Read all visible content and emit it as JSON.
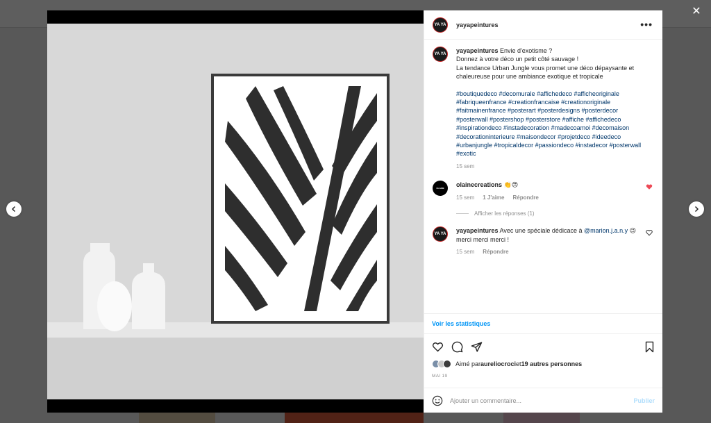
{
  "post": {
    "username": "yayapeintures",
    "avatar_text": "YA YA",
    "caption": "Envie d'exotisme ?\nDonnez à votre déco un petit côté sauvage !\nLa tendance Urban Jungle vous promet une déco dépaysante et chaleureuse pour une ambiance exotique et tropicale",
    "hashtags": "#boutiquedeco #decomurale #affichedeco #afficheoriginale #fabriqueenfrance #creationfrancaise #creationoriginale #faitmainenfrance #posterart #posterdesigns #posterdecor #posterwall #postershop #posterstore #affiche #affichedeco #inspirationdeco #instadecoration #madecoamoi #decomaison #decorationinterieure #maisondecor #projetdeco #ideedeco #urbanjungle #tropicaldecor #passiondeco #instadecor #posterwall #exotic",
    "caption_time": "15 sem"
  },
  "comments": [
    {
      "username": "olainecreations",
      "text": "👏😍",
      "time": "15 sem",
      "likes": "1 J'aime",
      "reply": "Répondre",
      "liked": true,
      "avatar_text": "OLAINE"
    },
    {
      "username": "yayapeintures",
      "text_before": "Avec une spéciale dédicace à ",
      "mention": "@marion.j.a.n.y",
      "text_after": " 😉 merci merci merci !",
      "time": "15 sem",
      "reply": "Répondre",
      "liked": false,
      "avatar_text": "YA YA"
    }
  ],
  "show_replies": "Afficher les réponses (1)",
  "stats_link": "Voir les statistiques",
  "likes": {
    "prefix": "Aimé par ",
    "user": "aureliocroci",
    "middle": " et ",
    "others": "19 autres personnes"
  },
  "date": "MAI 19",
  "comment_input": {
    "placeholder": "Ajouter un commentaire..."
  },
  "publish_label": "Publier",
  "close_label": "✕",
  "colors": {
    "link": "#00376b",
    "accent": "#0095f6",
    "like_red": "#ed4956"
  },
  "icons": [
    "close-icon",
    "chevron-left-icon",
    "chevron-right-icon",
    "more-icon",
    "heart-icon",
    "comment-icon",
    "share-icon",
    "bookmark-icon",
    "emoji-icon"
  ]
}
